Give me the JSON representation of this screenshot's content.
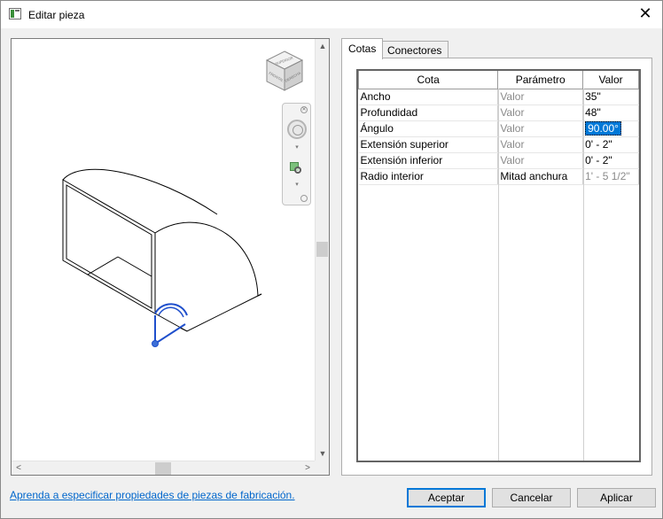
{
  "window": {
    "title": "Editar pieza"
  },
  "tabs": [
    {
      "label": "Cotas"
    },
    {
      "label": "Conectores"
    }
  ],
  "table": {
    "headers": [
      "Cota",
      "Parámetro",
      "Valor"
    ],
    "rows": [
      {
        "cota": "Ancho",
        "parametro": "Valor",
        "valor": "35\""
      },
      {
        "cota": "Profundidad",
        "parametro": "Valor",
        "valor": "48\""
      },
      {
        "cota": "Ángulo",
        "parametro": "Valor",
        "valor": "90.00°"
      },
      {
        "cota": "Extensión superior",
        "parametro": "Valor",
        "valor": "0' - 2\""
      },
      {
        "cota": "Extensión inferior",
        "parametro": "Valor",
        "valor": "0' - 2\""
      },
      {
        "cota": "Radio interior",
        "parametro": "Mitad anchura",
        "valor": "1' - 5 1/2\""
      }
    ]
  },
  "viewcube": {
    "faces": [
      "SUPERIOR",
      "FRONTAL",
      "DERECHA"
    ]
  },
  "footer": {
    "help_link": "Aprenda a especificar propiedades de piezas de fabricación.",
    "accept": "Aceptar",
    "cancel": "Cancelar",
    "apply": "Aplicar"
  },
  "colors": {
    "accent": "#0078d7",
    "selection": "#0078d7",
    "connector": "#1f4fcc"
  }
}
